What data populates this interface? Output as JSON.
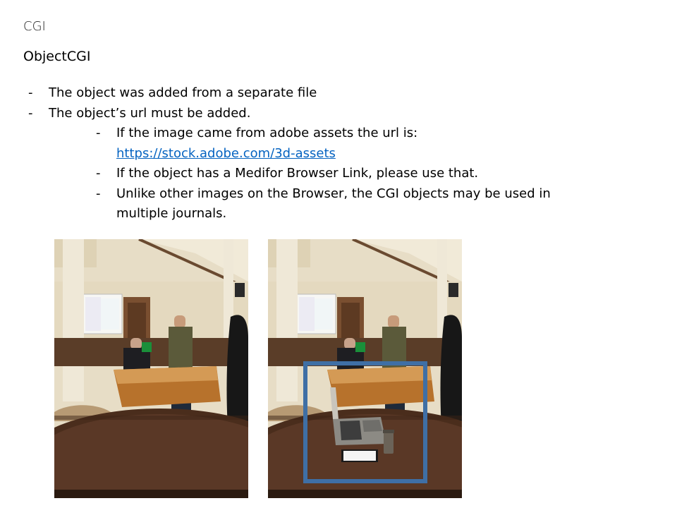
{
  "header": {
    "label": "CGI"
  },
  "title": "ObjectCGI",
  "bullets": [
    {
      "dash": "-",
      "text": "The object was added from a separate file"
    },
    {
      "dash": "-",
      "text": "The object’s url must be added."
    }
  ],
  "sub_bullets": [
    {
      "dash": "-",
      "text": "If the image came from adobe assets the url is:",
      "link": "https://stock.adobe.com/3d-assets"
    },
    {
      "dash": "-",
      "text": "If the object has a Medifor Browser Link, please use that."
    },
    {
      "dash": "-",
      "text": "Unlike other images on the Browser, the CGI objects may be used in multiple journals."
    }
  ],
  "images": {
    "left": {
      "label": "original-photo"
    },
    "right": {
      "label": "photo-with-cgi-laptop",
      "highlight_color": "#3f6fa5"
    }
  }
}
